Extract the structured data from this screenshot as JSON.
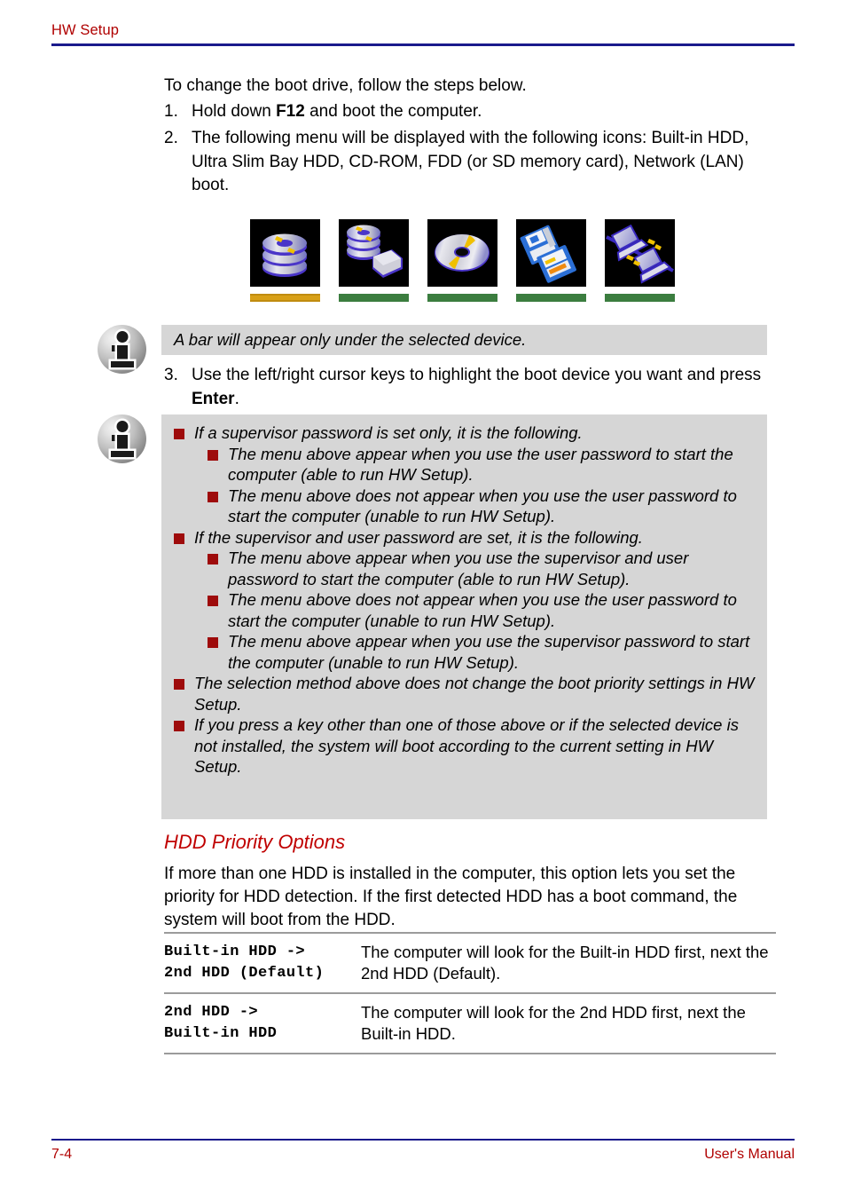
{
  "header": {
    "chapter_title": "HW Setup",
    "rule_color": "#1a1a8c",
    "title_color": "#b00000"
  },
  "intro": {
    "lead": "To change the boot drive, follow the steps below."
  },
  "steps": [
    {
      "number": "1.",
      "text_before": "Hold down ",
      "bold": "F12",
      "text_after": " and boot the computer."
    },
    {
      "number": "2.",
      "text_before": "The following menu will be displayed with the following icons: Built-in HDD, Ultra Slim Bay HDD, CD-ROM, FDD (or SD memory card), Network (LAN) boot.",
      "bold": "",
      "text_after": ""
    },
    {
      "number": "3.",
      "text_before": "Use the left/right cursor keys to highlight the boot device you want and press ",
      "bold": "Enter",
      "text_after": "."
    }
  ],
  "device_icons": {
    "selected_bar_color": "#d8a017",
    "unselected_bar_color": "#3b7d3f",
    "items": [
      {
        "name": "built-in-hdd-icon",
        "label": "Built-in HDD",
        "selected": true
      },
      {
        "name": "ultra-slim-bay-hdd-icon",
        "label": "Ultra Slim Bay HDD",
        "selected": false
      },
      {
        "name": "cd-rom-icon",
        "label": "CD-ROM",
        "selected": false
      },
      {
        "name": "fdd-sd-memory-icon",
        "label": "FDD (or SD memory card)",
        "selected": false
      },
      {
        "name": "network-lan-icon",
        "label": "Network (LAN)",
        "selected": false
      }
    ]
  },
  "note_one": {
    "icon": "info-icon",
    "text": "A bar will appear only under the selected device."
  },
  "note_two": {
    "icon": "info-icon",
    "bullet_color": "#9e0b0b",
    "bullets": [
      {
        "level": 1,
        "text": "If a supervisor password is set only, it is the following."
      },
      {
        "level": 2,
        "text": "The menu above appear when you use the user password to start the computer (able to run HW Setup)."
      },
      {
        "level": 2,
        "text": "The menu above does not appear when you use the user password to start the computer (unable to run HW Setup)."
      },
      {
        "level": 1,
        "text": "If the supervisor and user password are set, it is the following."
      },
      {
        "level": 2,
        "text": "The menu above appear when you use the supervisor and user password to start the computer (able to run HW Setup)."
      },
      {
        "level": 2,
        "text": "The menu above does not appear when you use the user password to start the computer (unable to run HW Setup)."
      },
      {
        "level": 2,
        "text": "The menu above appear when you use the supervisor password to start the computer (unable to run HW Setup)."
      },
      {
        "level": 1,
        "text": "The selection method above does not change the boot priority settings in HW Setup."
      },
      {
        "level": 1,
        "text": "If you press a key other than one of those above or if the selected device is not installed, the system will boot according to the current setting in HW Setup."
      }
    ]
  },
  "section": {
    "heading": "HDD Priority Options",
    "heading_color": "#c00000",
    "body": "If more than one HDD is installed in the computer, this option lets you set the priority for HDD detection. If the first detected HDD has a boot command, the system will boot from the HDD."
  },
  "hdd_table": {
    "rows": [
      {
        "term_line1": "Built-in HDD ->",
        "term_line2": "2nd HDD (Default)",
        "description": "The computer will look for the  Built-in HDD first, next the 2nd HDD (Default)."
      },
      {
        "term_line1": "2nd HDD ->",
        "term_line2": "Built-in HDD",
        "description": "The computer will look for the 2nd HDD first, next the Built-in HDD."
      }
    ]
  },
  "footer": {
    "page_number": "7-4",
    "manual_label": "User's Manual",
    "color": "#b00000"
  }
}
